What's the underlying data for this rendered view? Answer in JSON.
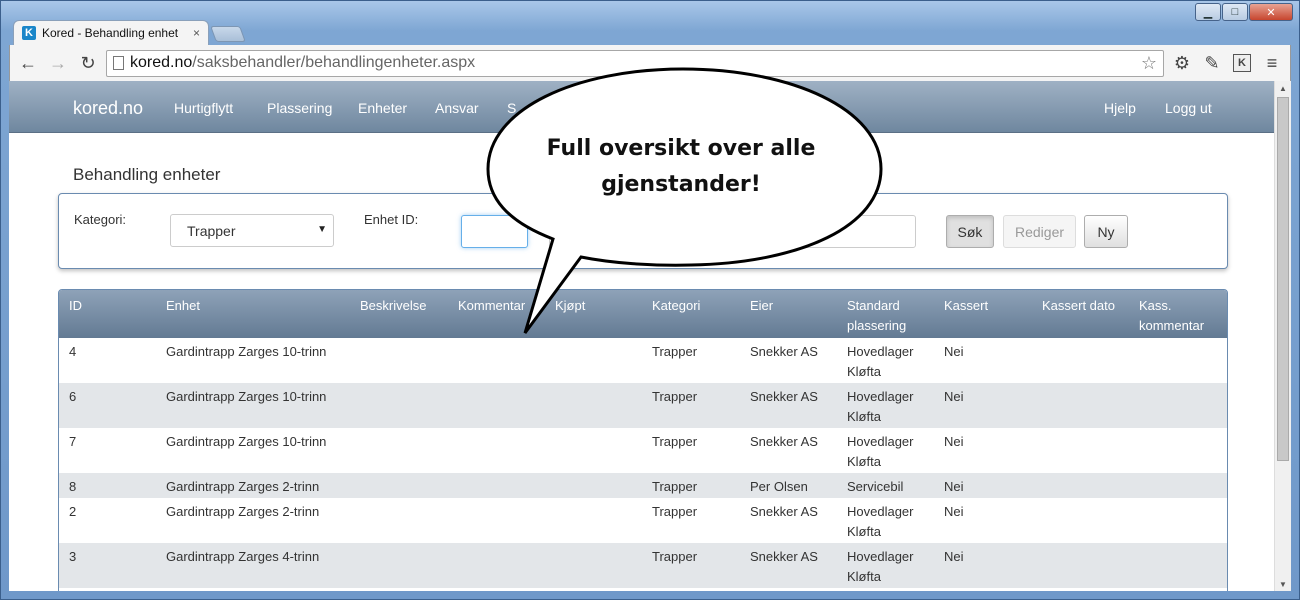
{
  "window": {
    "minimize_glyph": "▁",
    "maximize_glyph": "□",
    "close_glyph": "✕"
  },
  "tab": {
    "favicon": "K",
    "title": "Kored - Behandling enhet",
    "close": "×"
  },
  "toolbar": {
    "url_host": "kored.no",
    "url_path": "/saksbehandler/behandlingenheter.aspx",
    "back": "←",
    "forward": "→",
    "reload": "↻",
    "star": "☆",
    "gear": "⚙",
    "pin": "✎",
    "ext_k": "K",
    "menu": "≡"
  },
  "navbar": {
    "brand": "kored.no",
    "items": [
      "Hurtigflytt",
      "Plassering",
      "Enheter",
      "Ansvar",
      "S"
    ],
    "right": [
      "Hjelp",
      "Logg ut"
    ]
  },
  "page": {
    "title": "Behandling enheter"
  },
  "filter": {
    "kategori_label": "Kategori:",
    "kategori_value": "Trapper",
    "enhet_id_label": "Enhet ID:",
    "enhet_id_value": "",
    "search_value": "",
    "buttons": {
      "search": "Søk",
      "edit": "Rediger",
      "new": "Ny"
    }
  },
  "table": {
    "headers": [
      "ID",
      "Enhet",
      "Beskrivelse",
      "Kommentar",
      "Kjøpt",
      "Kategori",
      "Eier",
      "Standard plassering",
      "Kassert",
      "Kassert dato",
      "Kass. kommentar"
    ],
    "rows": [
      {
        "id": "4",
        "enhet": "Gardintrapp Zarges 10-trinn",
        "kategori": "Trapper",
        "eier": "Snekker AS",
        "plassering": "Hovedlager Kløfta",
        "kassert": "Nei"
      },
      {
        "id": "6",
        "enhet": "Gardintrapp Zarges 10-trinn",
        "kategori": "Trapper",
        "eier": "Snekker AS",
        "plassering": "Hovedlager Kløfta",
        "kassert": "Nei"
      },
      {
        "id": "7",
        "enhet": "Gardintrapp Zarges 10-trinn",
        "kategori": "Trapper",
        "eier": "Snekker AS",
        "plassering": "Hovedlager Kløfta",
        "kassert": "Nei"
      },
      {
        "id": "8",
        "enhet": "Gardintrapp Zarges 2-trinn",
        "kategori": "Trapper",
        "eier": "Per Olsen",
        "plassering": "Servicebil",
        "kassert": "Nei"
      },
      {
        "id": "2",
        "enhet": "Gardintrapp Zarges 2-trinn",
        "kategori": "Trapper",
        "eier": "Snekker AS",
        "plassering": "Hovedlager Kløfta",
        "kassert": "Nei"
      },
      {
        "id": "3",
        "enhet": "Gardintrapp Zarges 4-trinn",
        "kategori": "Trapper",
        "eier": "Snekker AS",
        "plassering": "Hovedlager Kløfta",
        "kassert": "Nei"
      }
    ]
  },
  "callout": {
    "line1": "Full oversikt over alle",
    "line2": "gjenstander!"
  }
}
